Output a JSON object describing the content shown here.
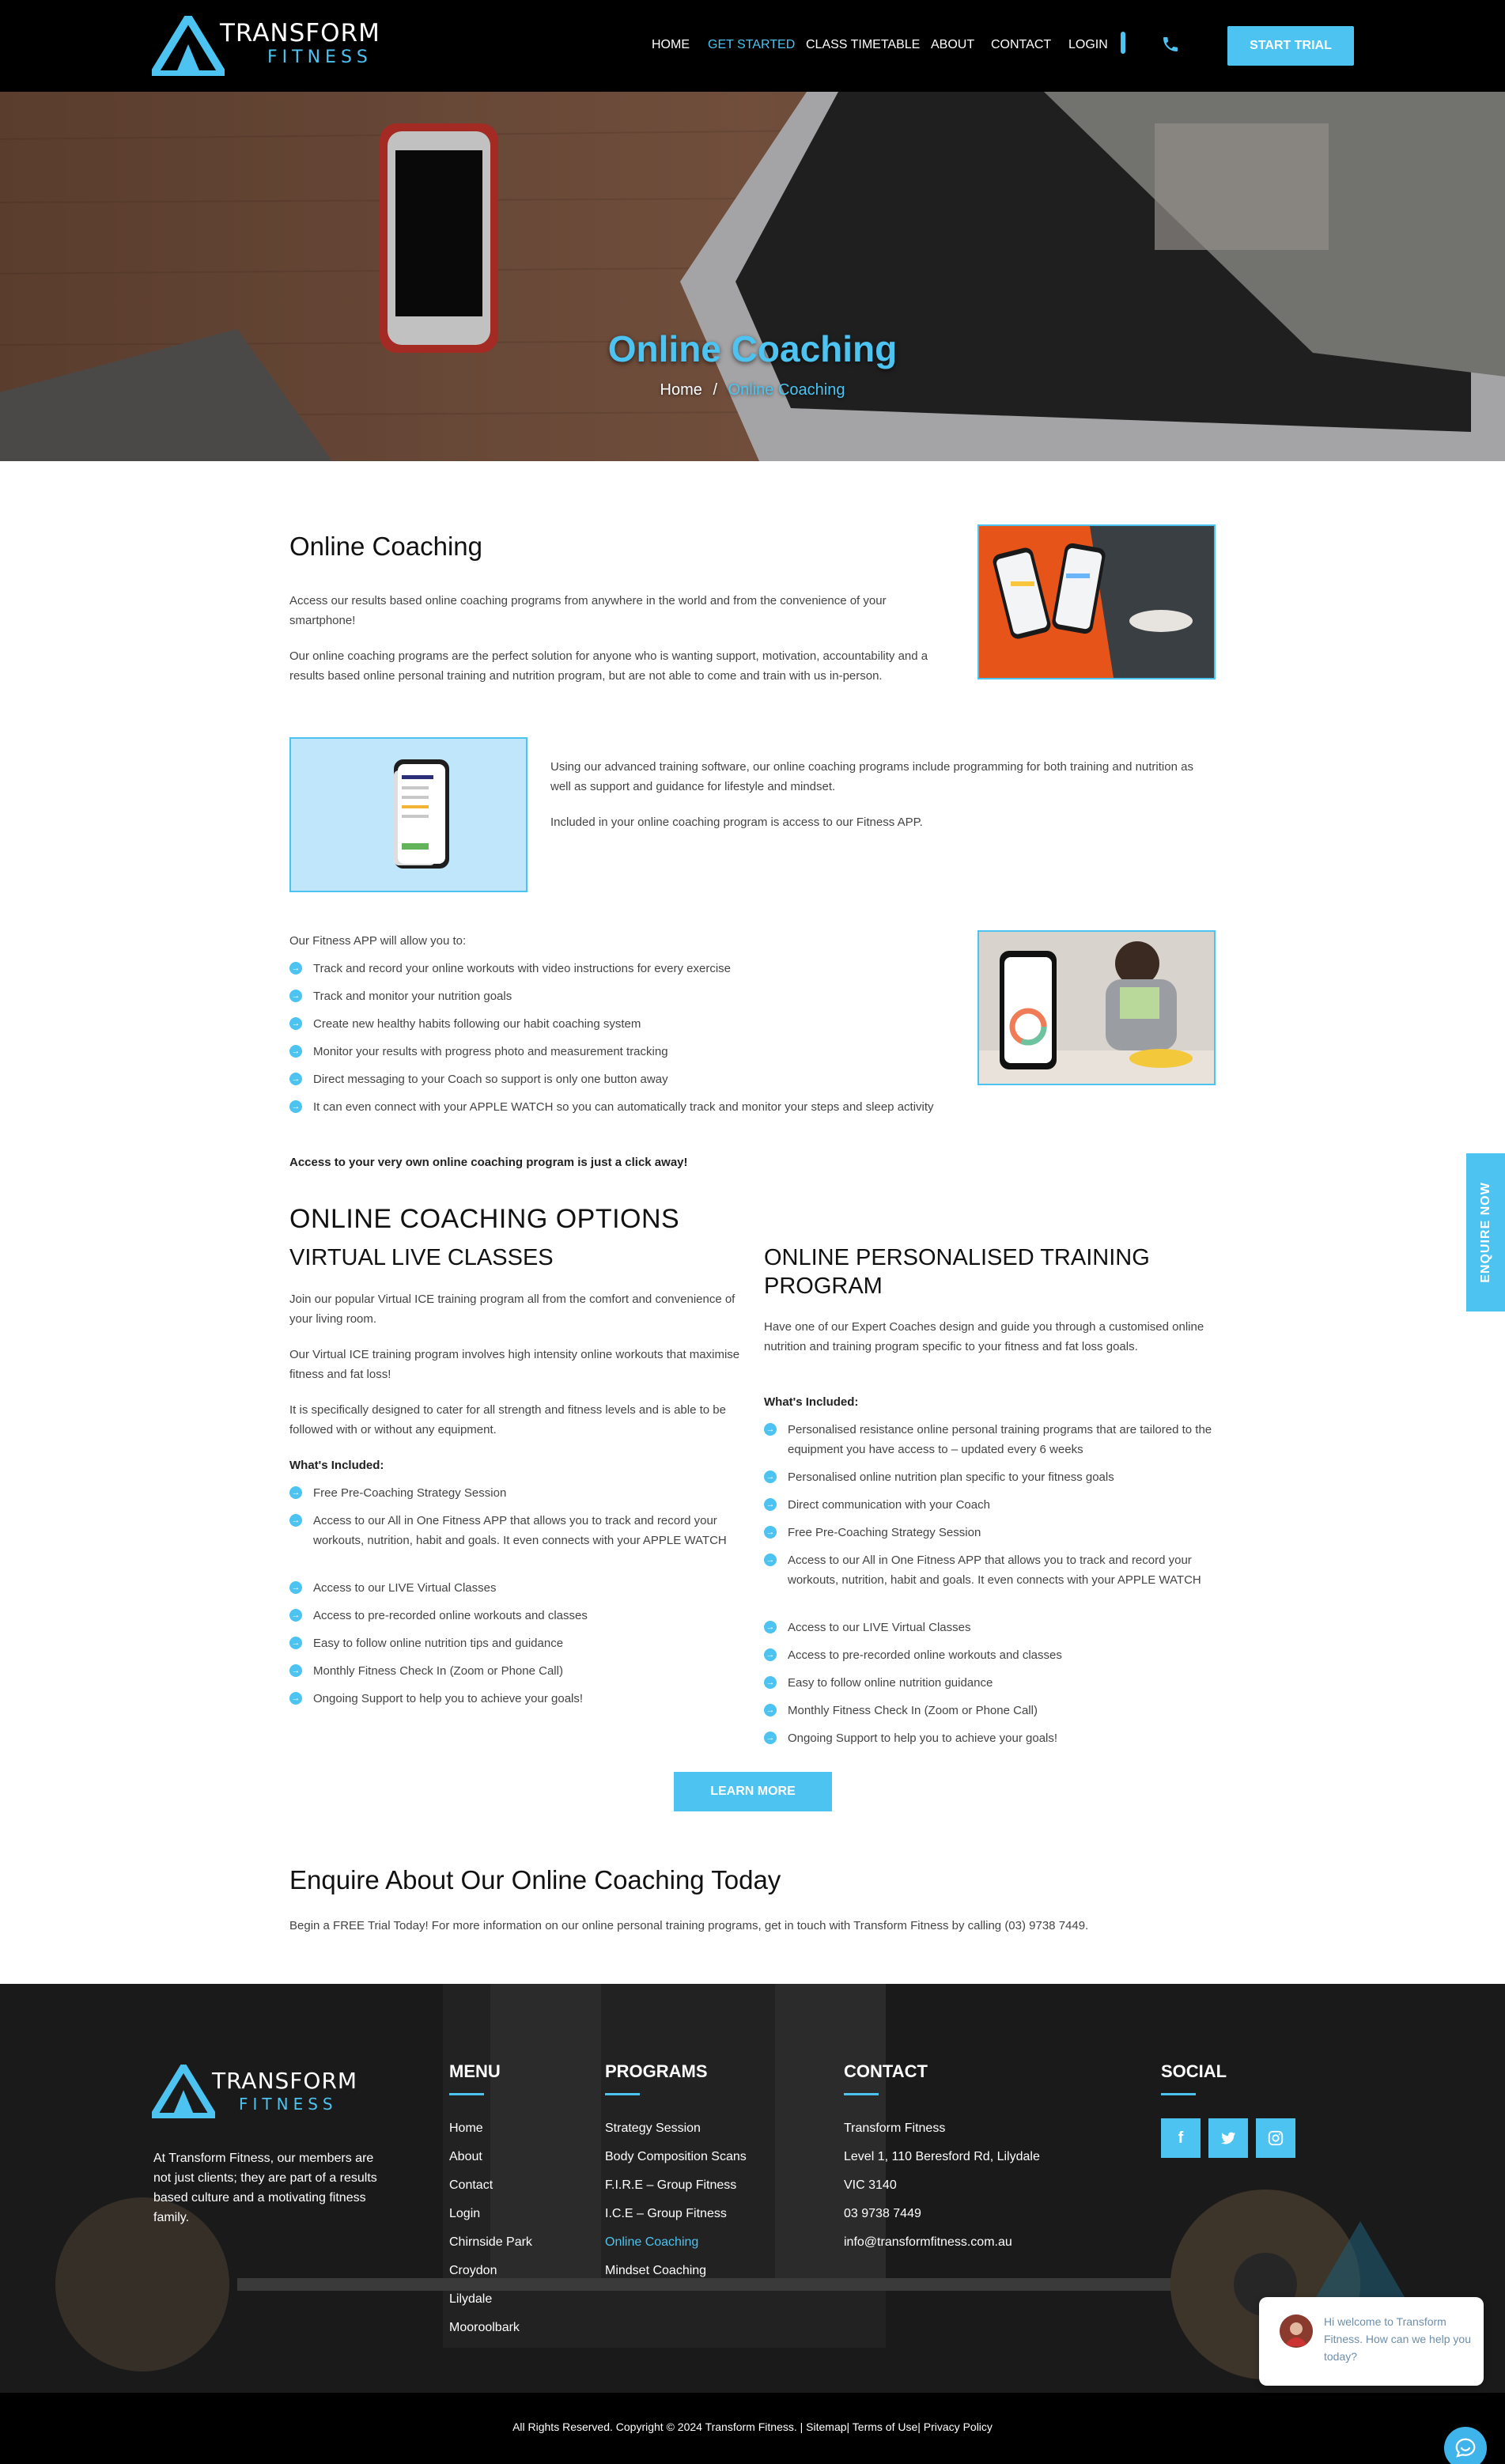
{
  "brand": {
    "name_top": "TRANSFORM",
    "name_bottom": "FITNESS",
    "accent": "#4cc3f0"
  },
  "nav": {
    "items": [
      "HOME",
      "GET STARTED",
      "CLASS TIMETABLE",
      "ABOUT",
      "CONTACT",
      "LOGIN"
    ],
    "active": "GET STARTED",
    "cta": "START TRIAL",
    "phone_icon": "phone-icon"
  },
  "hero": {
    "title": "Online Coaching",
    "crumb_home": "Home",
    "crumb_sep": "/",
    "crumb_current": "Online Coaching"
  },
  "intro": {
    "title": "Online Coaching",
    "p1": "Access our results based online coaching programs from anywhere in the world and from the convenience of your smartphone!",
    "p2": "Our online coaching programs are the perfect solution for anyone who is wanting support, motivation, accountability and a results based online personal training and nutrition program, but are not able to come and train with us in-person."
  },
  "software": {
    "p1": "Using our advanced training software, our online coaching programs include programming for both training and nutrition as well as support and guidance for lifestyle and mindset.",
    "p2": "Included in your online coaching program is access to our Fitness APP."
  },
  "app": {
    "intro": "Our Fitness APP will allow you to:",
    "items": [
      "Track and record your online workouts with video instructions for every exercise",
      "Track and monitor your nutrition goals",
      "Create new healthy habits following our habit coaching system",
      "Monitor your results with progress photo and measurement tracking",
      "Direct messaging to your Coach so support is only one button away",
      "It can even connect with your APPLE WATCH so you can automatically track and monitor your steps and sleep activity"
    ],
    "closing": "Access to your very own online coaching program is just a click away!"
  },
  "options": {
    "title": "ONLINE COACHING OPTIONS",
    "virtual": {
      "title": "VIRTUAL LIVE CLASSES",
      "p1": "Join our popular Virtual ICE training program all from the comfort and convenience of your living room.",
      "p2": "Our Virtual ICE training program involves high intensity online workouts that maximise fitness and fat loss!",
      "p3": "It is specifically designed to cater for all strength and fitness levels and is able to be followed with or without any equipment.",
      "included_label": "What's Included:",
      "items": [
        "Free Pre-Coaching Strategy Session",
        "Access to our All in One Fitness APP that allows you to track and record your workouts, nutrition, habit and goals. It even connects with your APPLE WATCH",
        "Access to our LIVE Virtual Classes",
        "Access to pre-recorded online workouts and classes",
        "Easy to follow online nutrition tips and guidance",
        "Monthly Fitness Check In (Zoom or Phone Call)",
        "Ongoing Support to help you to achieve your goals!"
      ]
    },
    "personal": {
      "title_line1": "ONLINE PERSONALISED TRAINING",
      "title_line2": "PROGRAM",
      "p1": "Have one of our Expert Coaches design and guide you through a customised online nutrition and training program specific to your fitness and fat loss goals.",
      "included_label": "What's Included:",
      "items": [
        "Personalised resistance online personal training programs that are tailored to the equipment you have access to – updated every 6 weeks",
        "Personalised online nutrition plan specific to your fitness goals",
        "Direct communication with your Coach",
        "Free Pre-Coaching Strategy Session",
        "Access to our All in One Fitness APP that allows you to track and record your workouts, nutrition, habit and goals. It even connects with your APPLE WATCH",
        "Access to our LIVE Virtual Classes",
        "Access to pre-recorded online workouts and classes",
        "Easy to follow online nutrition guidance",
        "Monthly Fitness Check In (Zoom or Phone Call)",
        "Ongoing Support to help you to achieve your goals!"
      ]
    },
    "button": "LEARN MORE"
  },
  "enquire": {
    "title": "Enquire About Our Online Coaching Today",
    "text": "Begin a FREE Trial Today! For more information on our online personal training programs, get in touch with Transform Fitness by calling (03) 9738 7449."
  },
  "footer": {
    "about": "At Transform Fitness, our members are not just clients; they are part of a results based culture and a motivating fitness family.",
    "menu_title": "MENU",
    "menu": [
      "Home",
      "About",
      "Contact",
      "Login",
      "Chirnside Park",
      "Croydon",
      "Lilydale",
      "Mooroolbark"
    ],
    "programs_title": "PROGRAMS",
    "programs": [
      "Strategy Session",
      "Body Composition Scans",
      "F.I.R.E – Group Fitness",
      "I.C.E – Group Fitness",
      "Online Coaching",
      "Mindset Coaching"
    ],
    "programs_active": "Online Coaching",
    "contact_title": "CONTACT",
    "contact": [
      "Transform Fitness",
      "Level 1, 110 Beresford Rd, Lilydale",
      "VIC 3140",
      "03 9738 7449",
      "info@transformfitness.com.au"
    ],
    "social_title": "SOCIAL",
    "social": [
      "facebook-icon",
      "twitter-icon",
      "instagram-icon"
    ],
    "copyright": "All Rights Reserved. Copyright © 2024 Transform Fitness. | Sitemap| Terms of Use| Privacy Policy"
  },
  "widgets": {
    "enquire_tab": "ENQUIRE NOW",
    "chat_text": "Hi welcome to Transform Fitness. How can we help you today?"
  }
}
